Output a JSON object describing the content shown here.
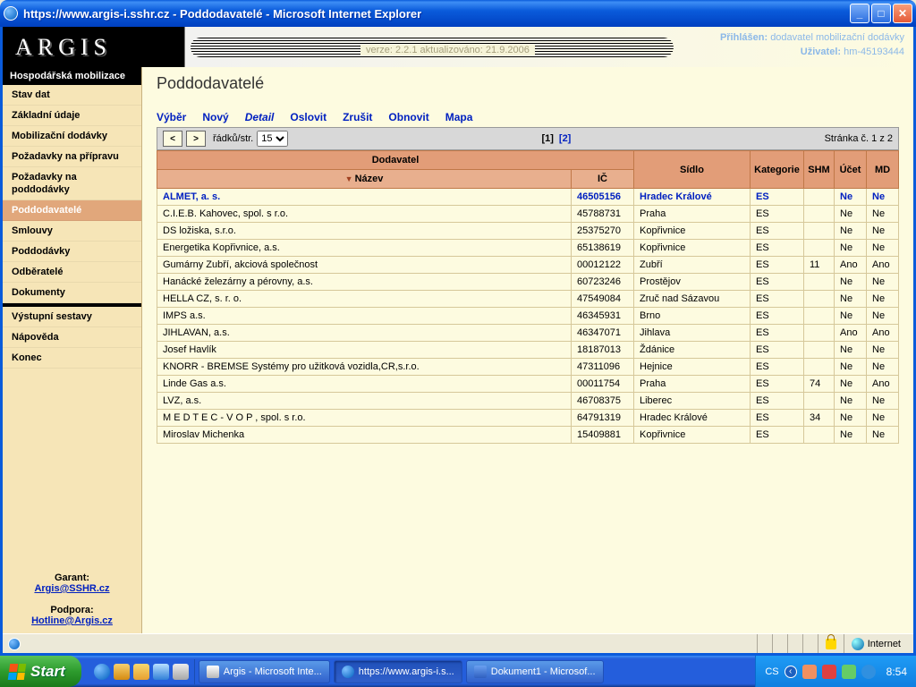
{
  "window": {
    "title": "https://www.argis-i.sshr.cz - Poddodavatelé - Microsoft Internet Explorer"
  },
  "header": {
    "logo": "ARGIS",
    "version": "verze: 2.2.1 aktualizováno: 21.9.2006",
    "logged_label": "Přihlášen:",
    "logged_value": "dodavatel mobilizační dodávky",
    "user_label": "Uživatel:",
    "user_value": "hm-45193444"
  },
  "sidebar": {
    "section": "Hospodářská mobilizace",
    "items": [
      {
        "label": "Stav dat"
      },
      {
        "label": "Základní údaje"
      },
      {
        "label": "Mobilizační dodávky"
      },
      {
        "label": "Požadavky na přípravu"
      },
      {
        "label": "Požadavky na poddodávky"
      },
      {
        "label": "Poddodavatelé",
        "active": true
      },
      {
        "label": "Smlouvy"
      },
      {
        "label": "Poddodávky"
      },
      {
        "label": "Odběratelé"
      },
      {
        "label": "Dokumenty"
      }
    ],
    "items2": [
      {
        "label": "Výstupní sestavy"
      },
      {
        "label": "Nápověda"
      },
      {
        "label": "Konec"
      }
    ],
    "garant_label": "Garant:",
    "garant_link": "Argis@SSHR.cz",
    "podpora_label": "Podpora:",
    "podpora_link": "Hotline@Argis.cz"
  },
  "page": {
    "title": "Poddodavatelé",
    "toolbar": [
      "Výběr",
      "Nový",
      "Detail",
      "Oslovit",
      "Zrušit",
      "Obnovit",
      "Mapa"
    ],
    "toolbar_active_index": 2,
    "rows_label": "řádků/str.",
    "rows_value": "15",
    "page_info": "Stránka č. 1 z 2",
    "pages": [
      "[1]",
      "[2]"
    ],
    "pages_current": 0
  },
  "table": {
    "cols_top": {
      "dodavatel": "Dodavatel",
      "sidlo": "Sídlo",
      "kategorie": "Kategorie",
      "shm": "SHM",
      "ucet": "Účet",
      "md": "MD"
    },
    "cols_sub": {
      "nazev": "Název",
      "ic": "IČ"
    },
    "rows": [
      {
        "sel": true,
        "nazev": "ALMET, a. s.",
        "ic": "46505156",
        "sidlo": "Hradec Králové",
        "kat": "ES",
        "shm": "",
        "ucet": "Ne",
        "md": "Ne"
      },
      {
        "nazev": "C.I.E.B. Kahovec, spol. s r.o.",
        "ic": "45788731",
        "sidlo": "Praha",
        "kat": "ES",
        "shm": "",
        "ucet": "Ne",
        "md": "Ne"
      },
      {
        "nazev": "DS ložiska, s.r.o.",
        "ic": "25375270",
        "sidlo": "Kopřivnice",
        "kat": "ES",
        "shm": "",
        "ucet": "Ne",
        "md": "Ne"
      },
      {
        "nazev": "Energetika Kopřivnice, a.s.",
        "ic": "65138619",
        "sidlo": "Kopřivnice",
        "kat": "ES",
        "shm": "",
        "ucet": "Ne",
        "md": "Ne"
      },
      {
        "nazev": "Gumárny Zubří, akciová společnost",
        "ic": "00012122",
        "sidlo": "Zubří",
        "kat": "ES",
        "shm": "11",
        "ucet": "Ano",
        "md": "Ano"
      },
      {
        "nazev": "Hanácké železárny a pérovny, a.s.",
        "ic": "60723246",
        "sidlo": "Prostějov",
        "kat": "ES",
        "shm": "",
        "ucet": "Ne",
        "md": "Ne"
      },
      {
        "nazev": "HELLA CZ, s. r. o.",
        "ic": "47549084",
        "sidlo": "Zruč nad Sázavou",
        "kat": "ES",
        "shm": "",
        "ucet": "Ne",
        "md": "Ne"
      },
      {
        "nazev": "IMPS a.s.",
        "ic": "46345931",
        "sidlo": "Brno",
        "kat": "ES",
        "shm": "",
        "ucet": "Ne",
        "md": "Ne"
      },
      {
        "nazev": "JIHLAVAN, a.s.",
        "ic": "46347071",
        "sidlo": "Jihlava",
        "kat": "ES",
        "shm": "",
        "ucet": "Ano",
        "md": "Ano"
      },
      {
        "nazev": "Josef Havlík",
        "ic": "18187013",
        "sidlo": "Ždánice",
        "kat": "ES",
        "shm": "",
        "ucet": "Ne",
        "md": "Ne"
      },
      {
        "nazev": "KNORR - BREMSE Systémy pro užitková vozidla,CR,s.r.o.",
        "ic": "47311096",
        "sidlo": "Hejnice",
        "kat": "ES",
        "shm": "",
        "ucet": "Ne",
        "md": "Ne"
      },
      {
        "nazev": "Linde Gas a.s.",
        "ic": "00011754",
        "sidlo": "Praha",
        "kat": "ES",
        "shm": "74",
        "ucet": "Ne",
        "md": "Ano"
      },
      {
        "nazev": "LVZ, a.s.",
        "ic": "46708375",
        "sidlo": "Liberec",
        "kat": "ES",
        "shm": "",
        "ucet": "Ne",
        "md": "Ne"
      },
      {
        "nazev": "M E D T E C - V O P , spol. s r.o.",
        "ic": "64791319",
        "sidlo": "Hradec Králové",
        "kat": "ES",
        "shm": "34",
        "ucet": "Ne",
        "md": "Ne"
      },
      {
        "nazev": "Miroslav Michenka",
        "ic": "15409881",
        "sidlo": "Kopřivnice",
        "kat": "ES",
        "shm": "",
        "ucet": "Ne",
        "md": "Ne"
      }
    ]
  },
  "status": {
    "zone": "Internet"
  },
  "taskbar": {
    "start": "Start",
    "tasks": [
      {
        "label": "Argis - Microsoft Inte..."
      },
      {
        "label": "https://www.argis-i.s...",
        "active": true
      },
      {
        "label": "Dokument1 - Microsof..."
      }
    ],
    "lang": "CS",
    "clock": "8:54"
  }
}
